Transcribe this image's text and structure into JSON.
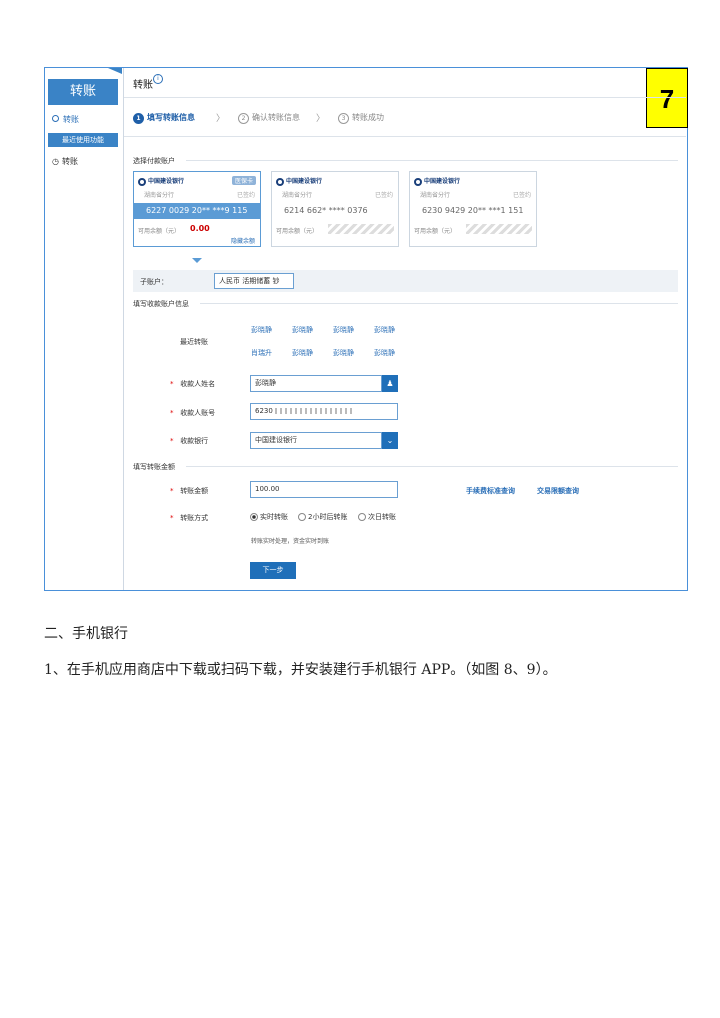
{
  "figure_number": "7",
  "sidebar": {
    "title": "转账",
    "item_transfer": "转账",
    "recent_functions": "最近使用功能",
    "item_recent_transfer": "转账"
  },
  "header": {
    "title": "转账",
    "steps": [
      {
        "num": "1",
        "label": "填写转账信息"
      },
      {
        "num": "2",
        "label": "确认转账信息"
      },
      {
        "num": "3",
        "label": "转账成功"
      }
    ]
  },
  "payer": {
    "section_title": "选择付款账户",
    "cards": [
      {
        "bank": "中国建设银行",
        "branch": "湖南省分行",
        "tag": "医保卡",
        "account": "6227 0029 20** ***9 115",
        "balance_label": "可用余额（元）",
        "balance": "0.00",
        "hide": "隐藏余额"
      },
      {
        "bank": "中国建设银行",
        "branch": "湖南省分行",
        "signed": "已签约",
        "account": "6214 662* **** 0376",
        "balance_label": "可用余额（元）"
      },
      {
        "bank": "中国建设银行",
        "branch": "湖南省分行",
        "signed": "已签约",
        "account": "6230 9429 20** ***1 151",
        "balance_label": "可用余额（元）"
      }
    ],
    "card1_signed": "已签约",
    "subaccount_label": "子账户：",
    "subaccount_value": "人民币 活期储蓄 钞"
  },
  "payee": {
    "section_title": "填写收款账户信息",
    "recent_label": "最近转账",
    "recent_names_row1": [
      "彭晓静",
      "彭晓静",
      "彭晓静",
      "彭晓静"
    ],
    "recent_names_row2": [
      "肖瑞升",
      "彭晓静",
      "彭晓静",
      "彭晓静"
    ],
    "name_label": "收款人姓名",
    "name_value": "彭晓静",
    "account_label": "收款人账号",
    "account_value": "6230 ",
    "bank_label": "收款银行",
    "bank_value": "中国建设银行"
  },
  "amount": {
    "section_title": "填写转账金额",
    "amount_label": "转账金额",
    "amount_value": "100.00",
    "fee_link": "手续费标准查询",
    "limit_link": "交易限额查询",
    "method_label": "转账方式",
    "methods": [
      "实时转账",
      "2小时后转账",
      "次日转账"
    ],
    "note": "转账实时处理，资金实时到账",
    "next_button": "下一步"
  },
  "body": {
    "heading": "二、手机银行",
    "paragraph": "1、在手机应用商店中下载或扫码下载，并安装建行手机银行 APP。（如图 8、9）。"
  }
}
